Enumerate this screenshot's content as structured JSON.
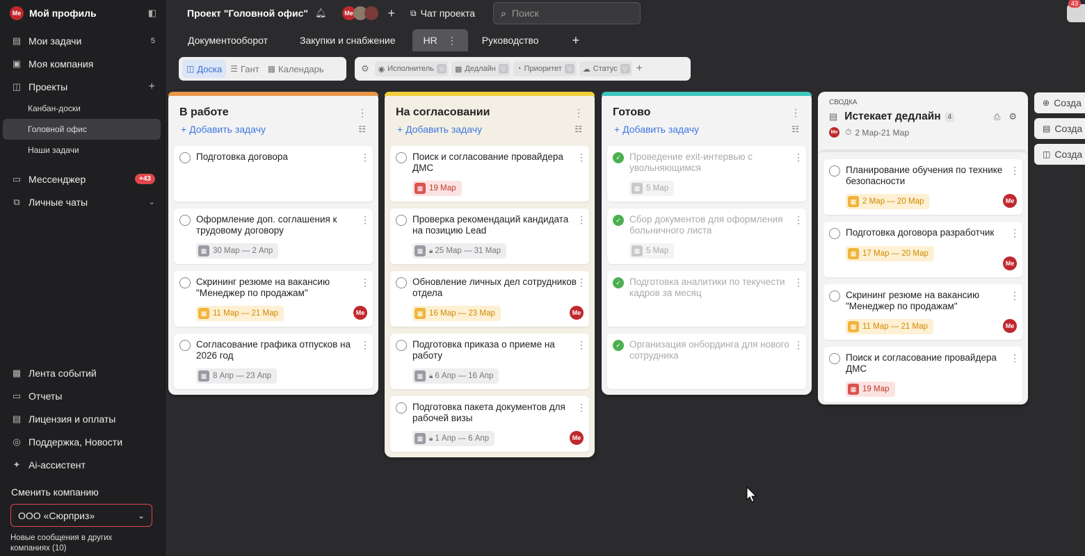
{
  "sidebar": {
    "profile": {
      "avatar": "Me",
      "name": "Мой профиль"
    },
    "items": [
      {
        "icon": "tasks-icon",
        "label": "Мои задачи",
        "count": "5"
      },
      {
        "icon": "company-icon",
        "label": "Моя компания"
      },
      {
        "icon": "projects-icon",
        "label": "Проекты"
      }
    ],
    "subitems": [
      "Канбан-доски",
      "Головной офис",
      "Наши задачи"
    ],
    "messenger": {
      "label": "Мессенджер",
      "badge": "+43"
    },
    "chats": {
      "label": "Личные чаты"
    },
    "bottom": [
      "Лента событий",
      "Отчеты",
      "Лицензия и оплаты",
      "Поддержка, Новости",
      "Ai-ассистент"
    ],
    "switch_label": "Сменить компанию",
    "company": "ООО «Сюрприз»",
    "new_messages": "Новые сообщения в других компаниях (10)"
  },
  "topbar": {
    "project_title": "Проект \"Головной офис\"",
    "chat_label": "Чат проекта",
    "search_placeholder": "Поиск",
    "notif_count": "43"
  },
  "tabs": [
    "Документооборот",
    "Закупки и снабжение",
    "HR",
    "Руководство"
  ],
  "views": [
    "Доска",
    "Гант",
    "Календарь"
  ],
  "filters": [
    "Исполнитель",
    "Дедлайн",
    "Приоритет",
    "Статус"
  ],
  "columns": [
    {
      "title": "В работе",
      "add": "Добавить задачу",
      "color": "#e8964a",
      "cards": [
        {
          "title": "Подготовка договора"
        },
        {
          "title": "Оформление доп. соглашения к трудовому договору",
          "date": "30 Мар — 2 Апр",
          "style": "grey"
        },
        {
          "title": "Скрининг резюме на вакансию \"Менеджер по продажам\"",
          "date": "11 Мар — 21 Мар",
          "style": "orange",
          "avatar": "Me"
        },
        {
          "title": "Согласование графика отпусков на 2026 год",
          "date": "8 Апр — 23 Апр",
          "style": "grey"
        }
      ]
    },
    {
      "title": "На согласовании",
      "add": "Добавить задачу",
      "color": "#f2cf3a",
      "cards": [
        {
          "title": "Поиск и согласование провайдера ДМС",
          "date": "19 Мар",
          "style": "red"
        },
        {
          "title": "Проверка рекомендаций кандидата на позицию Lead",
          "date": "25 Мар — 31 Мар",
          "style": "grey",
          "lock": true
        },
        {
          "title": "Обновление личных дел сотрудников отдела",
          "date": "16 Мар — 23 Мар",
          "style": "orange",
          "avatar": "Me"
        },
        {
          "title": "Подготовка приказа о приеме на работу",
          "date": "6 Апр — 16 Апр",
          "style": "grey",
          "lock": true
        },
        {
          "title": "Подготовка пакета документов для рабочей визы",
          "date": "1 Апр — 6 Апр",
          "style": "grey",
          "lock": true,
          "avatar": "Me"
        }
      ]
    },
    {
      "title": "Готово",
      "add": "Добавить задачу",
      "color": "#3fc7bd",
      "cards": [
        {
          "title": "Проведение exit-интервью с увольняющимся",
          "date": "5 Мар",
          "style": "dim",
          "done": true
        },
        {
          "title": "Сбор документов для оформления больничного листа",
          "date": "5 Мар",
          "style": "dim",
          "done": true
        },
        {
          "title": "Подготовка аналитики по текучести кадров за месяц",
          "done": true
        },
        {
          "title": "Организация онбординга для нового сотрудника",
          "done": true
        }
      ]
    }
  ],
  "summary": {
    "label": "СВОДКА",
    "title": "Истекает дедлайн",
    "count": "4",
    "range": "2 Мар-21 Мар",
    "cards": [
      {
        "title": "Планирование обучения по технике безопасности",
        "date": "2 Мар — 20 Мар",
        "style": "orange",
        "avatar": "Me"
      },
      {
        "title": "Подготовка договора разработчик",
        "date": "17 Мар — 20 Мар",
        "style": "orange",
        "avatar": "Me"
      },
      {
        "title": "Скрининг резюме на вакансию \"Менеджер по продажам\"",
        "date": "11 Мар — 21 Мар",
        "style": "orange",
        "avatar": "Me"
      },
      {
        "title": "Поиск и согласование провайдера ДМС",
        "date": "19 Мар",
        "style": "red"
      }
    ]
  },
  "right_buttons": [
    "Созда",
    "Созда",
    "Созда"
  ]
}
